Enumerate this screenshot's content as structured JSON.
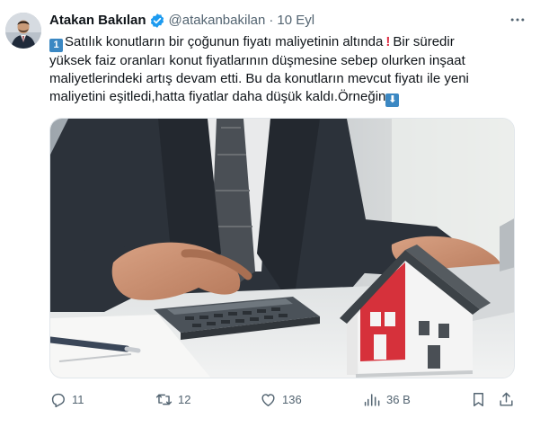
{
  "author": {
    "name": "Atakan Bakılan",
    "handle": "@atakanbakilan",
    "separator": "·",
    "date": "10 Eyl",
    "verified": true
  },
  "tweet": {
    "lines": [
      {
        "prefix_emoji": "1",
        "text": "Satılık konutların bir çoğunun fiyatı maliyetinin altında",
        "suffix_emoji": "!",
        "tail": "Bir süredir"
      },
      {
        "text": "yüksek faiz oranları konut fiyatlarının düşmesine sebep olurken inşaat"
      },
      {
        "text": "maliyetlerindeki artış devam etti. Bu da konutların mevcut fiyatı ile yeni"
      },
      {
        "text": "maliyetini eşitledi,hatta fiyatlar daha düşük kaldı.Örneğin",
        "suffix_emoji": "⬇"
      }
    ]
  },
  "media": {
    "icon": "photo-image"
  },
  "actions": {
    "reply_count": "11",
    "retweet_count": "12",
    "like_count": "136",
    "views_count": "36 B"
  },
  "colors": {
    "text": "#0f1419",
    "secondary": "#536471",
    "verified": "#1d9bf0",
    "keycap": "#3b88c3"
  }
}
